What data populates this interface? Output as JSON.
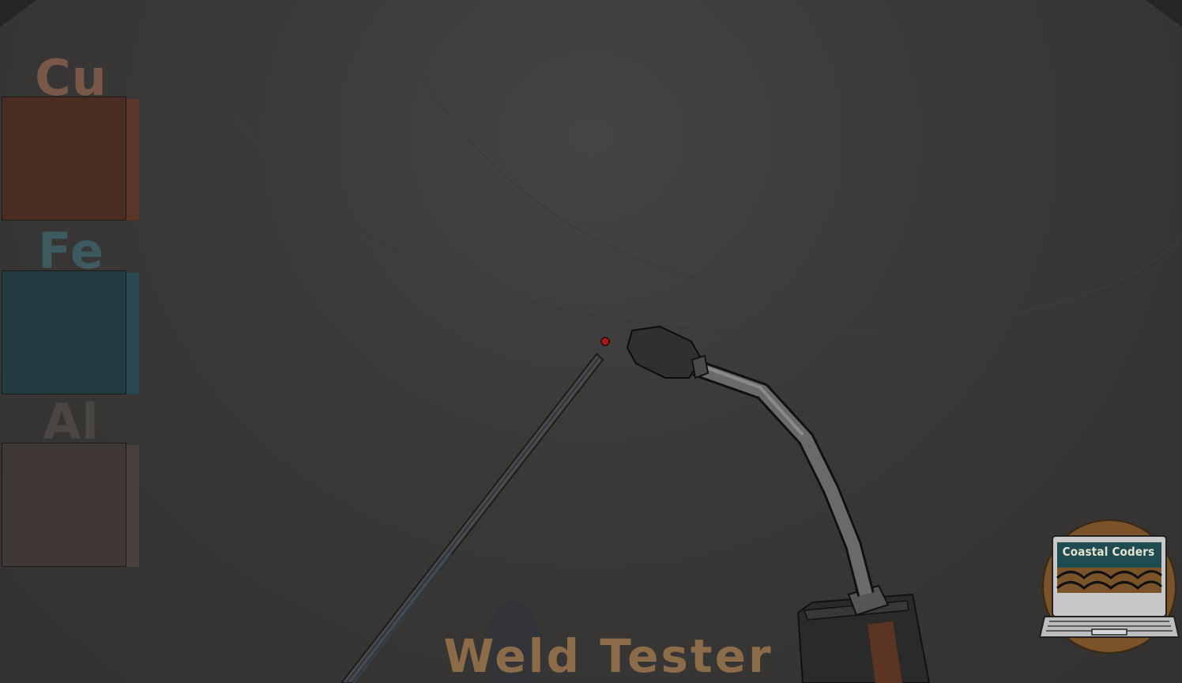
{
  "hud": {
    "title": "Weld Tester",
    "title_color": "#8c6c48"
  },
  "metals": [
    {
      "symbol": "Cu",
      "label_color": "#7a5849",
      "block_color": "#4b2c23",
      "side_color": "#5a3528"
    },
    {
      "symbol": "Fe",
      "label_color": "#3d5a60",
      "block_color": "#223a40",
      "side_color": "#2a4850"
    },
    {
      "symbol": "Al",
      "label_color": "#4a4644",
      "block_color": "#403836",
      "side_color": "#4a403d"
    }
  ],
  "logo": {
    "text": "Coastal Coders",
    "circle_color": "#7a5428",
    "screen_color": "#1f4c50"
  },
  "icons": [
    "welding-rod-icon",
    "welding-torch-icon",
    "spark-icon",
    "laptop-logo-icon"
  ]
}
